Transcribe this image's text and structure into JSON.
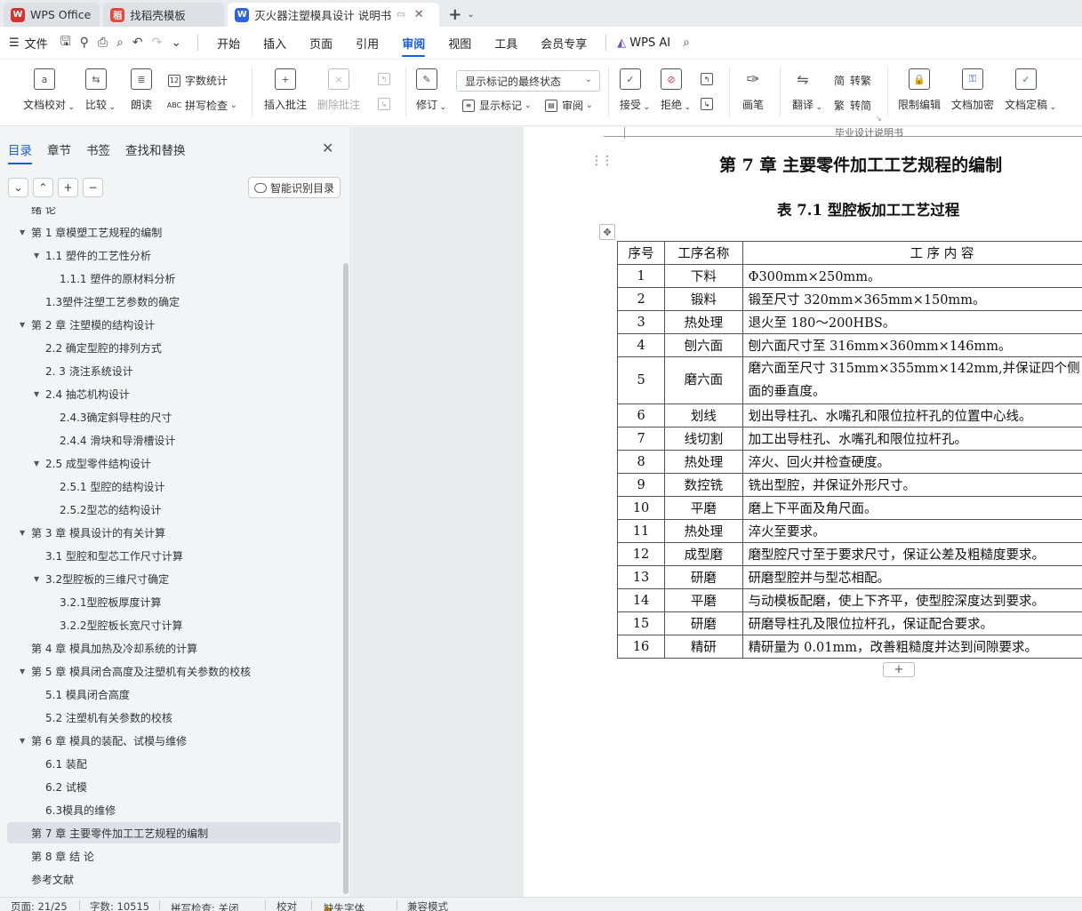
{
  "titlebar": {
    "tabs": [
      {
        "label": "WPS Office",
        "icon": "wps-logo-icon",
        "color": "#d8322e"
      },
      {
        "label": "找稻壳模板",
        "icon": "docer-logo-icon",
        "color": "#e5483d"
      },
      {
        "label": "灭火器注塑模具设计 说明书",
        "icon": "writer-logo-icon",
        "color": "#2c64e3"
      }
    ],
    "new_tab": "+"
  },
  "menubar": {
    "file_label": "文件",
    "tabs": [
      "开始",
      "插入",
      "页面",
      "引用",
      "审阅",
      "视图",
      "工具",
      "会员专享"
    ],
    "active_tab": "审阅",
    "ai_label": "WPS AI"
  },
  "ribbon": {
    "doc_check": "文档校对",
    "compare": "比较",
    "read_aloud": "朗读",
    "word_count": "字数统计",
    "spell_check": "拼写检查",
    "insert_comment": "插入批注",
    "delete_comment": "删除批注",
    "revise": "修订",
    "show_mode": "显示标记的最终状态",
    "show_markup": "显示标记",
    "review": "审阅",
    "accept": "接受",
    "reject": "拒绝",
    "pen": "画笔",
    "translate": "翻译",
    "to_traditional": "转繁",
    "to_simplified": "转简",
    "restrict_edit": "限制编辑",
    "encrypt": "文档加密",
    "finalize": "文档定稿"
  },
  "sidepanel": {
    "tabs": [
      "目录",
      "章节",
      "书签",
      "查找和替换"
    ],
    "active_tab": "目录",
    "smart_toc": "智能识别目录",
    "toc": [
      {
        "label": "绪 论",
        "level": 1,
        "arrow": false
      },
      {
        "label": "第 1 章模塑工艺规程的编制",
        "level": 1,
        "arrow": true
      },
      {
        "label": "1.1  塑件的工艺性分析",
        "level": 2,
        "arrow": true
      },
      {
        "label": "1.1.1   塑件的原材料分析",
        "level": 3,
        "arrow": false
      },
      {
        "label": "1.3塑件注塑工艺参数的确定",
        "level": 2,
        "arrow": false
      },
      {
        "label": "第 2 章  注塑模的结构设计",
        "level": 1,
        "arrow": true
      },
      {
        "label": "2.2  确定型腔的排列方式",
        "level": 2,
        "arrow": false
      },
      {
        "label": "2.  3  浇注系统设计",
        "level": 2,
        "arrow": false
      },
      {
        "label": "2.4  抽芯机构设计",
        "level": 2,
        "arrow": true
      },
      {
        "label": "2.4.3确定斜导柱的尺寸",
        "level": 3,
        "arrow": false
      },
      {
        "label": "2.4.4  滑块和导滑槽设计",
        "level": 3,
        "arrow": false
      },
      {
        "label": "2.5  成型零件结构设计",
        "level": 2,
        "arrow": true
      },
      {
        "label": "2.5.1  型腔的结构设计",
        "level": 3,
        "arrow": false
      },
      {
        "label": "2.5.2型芯的结构设计",
        "level": 3,
        "arrow": false
      },
      {
        "label": "第 3 章  模具设计的有关计算",
        "level": 1,
        "arrow": true
      },
      {
        "label": "3.1  型腔和型芯工作尺寸计算",
        "level": 2,
        "arrow": false
      },
      {
        "label": "3.2型腔板的三维尺寸确定",
        "level": 2,
        "arrow": true
      },
      {
        "label": "3.2.1型腔板厚度计算",
        "level": 3,
        "arrow": false
      },
      {
        "label": "3.2.2型腔板长宽尺寸计算",
        "level": 3,
        "arrow": false
      },
      {
        "label": "第 4 章  模具加热及冷却系统的计算",
        "level": 1,
        "arrow": false
      },
      {
        "label": "第 5 章  模具闭合高度及注塑机有关参数的校核",
        "level": 1,
        "arrow": true
      },
      {
        "label": "5.1  模具闭合高度",
        "level": 2,
        "arrow": false
      },
      {
        "label": "5.2  注塑机有关参数的校核",
        "level": 2,
        "arrow": false
      },
      {
        "label": "第 6 章  模具的装配、试模与维修",
        "level": 1,
        "arrow": true
      },
      {
        "label": "6.1  装配",
        "level": 2,
        "arrow": false
      },
      {
        "label": "6.2  试模",
        "level": 2,
        "arrow": false
      },
      {
        "label": "6.3模具的维修",
        "level": 2,
        "arrow": false
      },
      {
        "label": "第 7 章  主要零件加工工艺规程的编制",
        "level": 1,
        "arrow": false,
        "selected": true
      },
      {
        "label": "第 8 章  结    论",
        "level": 1,
        "arrow": false
      },
      {
        "label": "参考文献",
        "level": 1,
        "arrow": false
      }
    ]
  },
  "document": {
    "header_text": "毕业设计说明书",
    "chapter_title": "第 7 章  主要零件加工工艺规程的编制",
    "table_caption": "表 7.1  型腔板加工工艺过程",
    "table": {
      "headers": [
        "序号",
        "工序名称",
        "工    序    内    容"
      ],
      "rows": [
        [
          "1",
          "下料",
          "Φ300mm×250mm。"
        ],
        [
          "2",
          "锻料",
          "锻至尺寸 320mm×365mm×150mm。"
        ],
        [
          "3",
          "热处理",
          "退火至 180～200HBS。"
        ],
        [
          "4",
          "刨六面",
          "刨六面尺寸至 316mm×360mm×146mm。"
        ],
        [
          "5",
          "磨六面",
          "磨六面至尺寸 315mm×355mm×142mm,并保证四个侧面的垂直度。"
        ],
        [
          "6",
          "划线",
          "划出导柱孔、水嘴孔和限位拉杆孔的位置中心线。"
        ],
        [
          "7",
          "线切割",
          "加工出导柱孔、水嘴孔和限位拉杆孔。"
        ],
        [
          "8",
          "热处理",
          "淬火、回火并检查硬度。"
        ],
        [
          "9",
          "数控铣",
          "铣出型腔，并保证外形尺寸。"
        ],
        [
          "10",
          "平磨",
          "磨上下平面及角尺面。"
        ],
        [
          "11",
          "热处理",
          "淬火至要求。"
        ],
        [
          "12",
          "成型磨",
          "磨型腔尺寸至于要求尺寸，保证公差及粗糙度要求。"
        ],
        [
          "13",
          "研磨",
          "研磨型腔并与型芯相配。"
        ],
        [
          "14",
          "平磨",
          "与动模板配磨，使上下齐平，使型腔深度达到要求。"
        ],
        [
          "15",
          "研磨",
          "研磨导柱孔及限位拉杆孔，保证配合要求。"
        ],
        [
          "16",
          "精研",
          "精研量为 0.01mm，改善粗糙度并达到间隙要求。"
        ]
      ]
    }
  },
  "statusbar": {
    "page": "页面: 21/25",
    "words": "字数: 10515",
    "spell": "拼写检查: 关闭",
    "proof": "校对",
    "missing_font": "缺失字体",
    "compat": "兼容模式"
  }
}
